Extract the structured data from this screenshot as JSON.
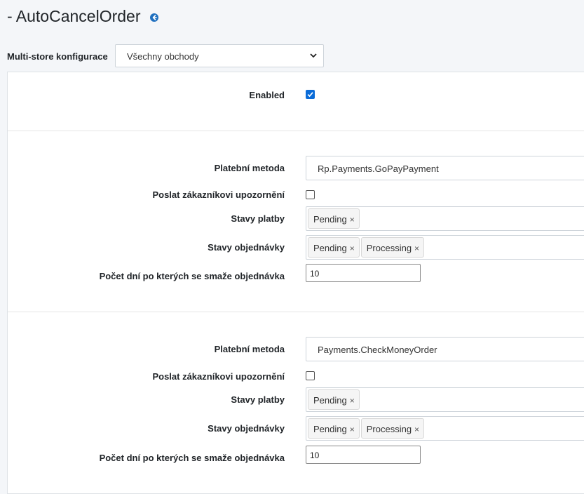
{
  "header": {
    "title": "- AutoCancelOrder"
  },
  "multistore": {
    "label": "Multi-store konfigurace",
    "selected": "Všechny obchody"
  },
  "enabled": {
    "label": "Enabled",
    "checked": true
  },
  "rules": [
    {
      "payment_method_label": "Platební metoda",
      "payment_method": "Rp.Payments.GoPayPayment",
      "notify_label": "Poslat zákazníkovi upozornění",
      "notify_checked": false,
      "payment_states_label": "Stavy platby",
      "payment_states": [
        "Pending"
      ],
      "order_states_label": "Stavy objednávky",
      "order_states": [
        "Pending",
        "Processing"
      ],
      "days_label": "Počet dní po kterých se smaže objednávka",
      "days": "10"
    },
    {
      "payment_method_label": "Platební metoda",
      "payment_method": "Payments.CheckMoneyOrder",
      "notify_label": "Poslat zákazníkovi upozornění",
      "notify_checked": false,
      "payment_states_label": "Stavy platby",
      "payment_states": [
        "Pending"
      ],
      "order_states_label": "Stavy objednávky",
      "order_states": [
        "Pending",
        "Processing"
      ],
      "days_label": "Počet dní po kterých se smaže objednávka",
      "days": "10"
    }
  ],
  "tag_remove_glyph": "×",
  "colors": {
    "accent": "#0b6cd8",
    "back_icon": "#1f6fbf"
  },
  "icons": {
    "back": "arrow-left-circle-icon",
    "select": "chevron-down-icon",
    "check": "checkmark-icon"
  }
}
